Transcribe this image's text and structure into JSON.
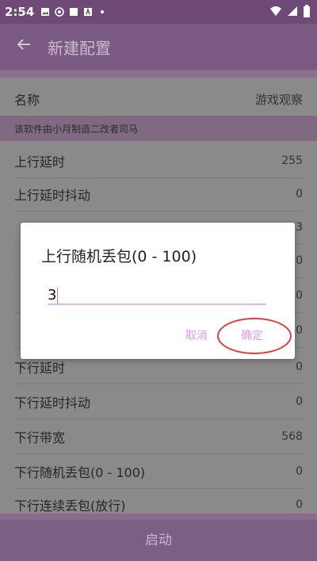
{
  "statusbar": {
    "time": "2:54",
    "icons": [
      "image-icon",
      "record-icon",
      "square-icon",
      "a-icon",
      "dot-icon"
    ],
    "right_icons": [
      "wifi-icon",
      "signal-icon",
      "battery-icon"
    ]
  },
  "appbar": {
    "title": "新建配置"
  },
  "form": {
    "name_label": "名称",
    "name_value": "游戏观察",
    "notice": "该软件由小月制造二改者司马",
    "rows": [
      {
        "label": "上行延时",
        "value": "255"
      },
      {
        "label": "上行延时抖动",
        "value": "0"
      },
      {
        "label": "",
        "value": "3"
      },
      {
        "label": "",
        "value": "0"
      },
      {
        "label": "",
        "value": "0"
      },
      {
        "label": "",
        "value": "0"
      },
      {
        "label": "下行延时",
        "value": "0"
      },
      {
        "label": "下行延时抖动",
        "value": "0"
      },
      {
        "label": "下行带宽",
        "value": "568"
      },
      {
        "label": "下行随机丢包(0 - 100)",
        "value": "0"
      },
      {
        "label": "下行连续丢包(放行)",
        "value": "0"
      }
    ]
  },
  "bottom": {
    "start_label": "启动"
  },
  "dialog": {
    "title": "上行随机丢包(0 - 100)",
    "input_value": "3",
    "cancel_label": "取消",
    "ok_label": "确定"
  }
}
